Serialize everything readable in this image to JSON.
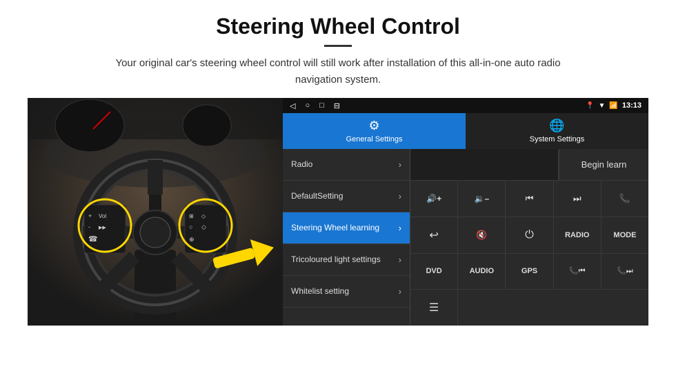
{
  "header": {
    "title": "Steering Wheel Control",
    "divider": true,
    "subtitle": "Your original car's steering wheel control will still work after installation of this all-in-one auto radio navigation system."
  },
  "statusBar": {
    "navIcons": [
      "◁",
      "○",
      "□",
      "⊟"
    ],
    "rightIcons": [
      "📍",
      "▼",
      "📶"
    ],
    "time": "13:13"
  },
  "tabs": [
    {
      "id": "general",
      "label": "General Settings",
      "icon": "⚙",
      "active": true
    },
    {
      "id": "system",
      "label": "System Settings",
      "icon": "🌐",
      "active": false
    }
  ],
  "menuItems": [
    {
      "id": "radio",
      "label": "Radio",
      "active": false
    },
    {
      "id": "default",
      "label": "DefaultSetting",
      "active": false
    },
    {
      "id": "steering",
      "label": "Steering Wheel learning",
      "active": true
    },
    {
      "id": "tricolour",
      "label": "Tricoloured light settings",
      "active": false
    },
    {
      "id": "whitelist",
      "label": "Whitelist setting",
      "active": false
    }
  ],
  "controlPanel": {
    "beginLearnLabel": "Begin learn",
    "buttons": {
      "row1": [
        {
          "id": "vol-up",
          "icon": "🔊+",
          "label": "Volume Up"
        },
        {
          "id": "vol-down",
          "icon": "🔉-",
          "label": "Volume Down"
        },
        {
          "id": "prev-track",
          "icon": "⏮",
          "label": "Previous Track"
        },
        {
          "id": "next-track",
          "icon": "⏭",
          "label": "Next Track"
        },
        {
          "id": "phone",
          "icon": "📞",
          "label": "Phone"
        }
      ],
      "row2": [
        {
          "id": "answer",
          "icon": "↩",
          "label": "Answer"
        },
        {
          "id": "mute",
          "icon": "🔇",
          "label": "Mute"
        },
        {
          "id": "power",
          "icon": "⏻",
          "label": "Power"
        },
        {
          "id": "radio-btn",
          "icon": "RADIO",
          "label": "Radio",
          "isText": true
        },
        {
          "id": "mode",
          "icon": "MODE",
          "label": "Mode",
          "isText": true
        }
      ],
      "row3": [
        {
          "id": "dvd",
          "icon": "DVD",
          "label": "DVD",
          "isText": true
        },
        {
          "id": "audio",
          "icon": "AUDIO",
          "label": "Audio",
          "isText": true
        },
        {
          "id": "gps",
          "icon": "GPS",
          "label": "GPS",
          "isText": true
        },
        {
          "id": "tel-prev",
          "icon": "📞⏮",
          "label": "Tel Prev"
        },
        {
          "id": "tel-next",
          "icon": "📞⏭",
          "label": "Tel Next"
        }
      ],
      "row4": [
        {
          "id": "list",
          "icon": "☰",
          "label": "List"
        }
      ]
    }
  }
}
